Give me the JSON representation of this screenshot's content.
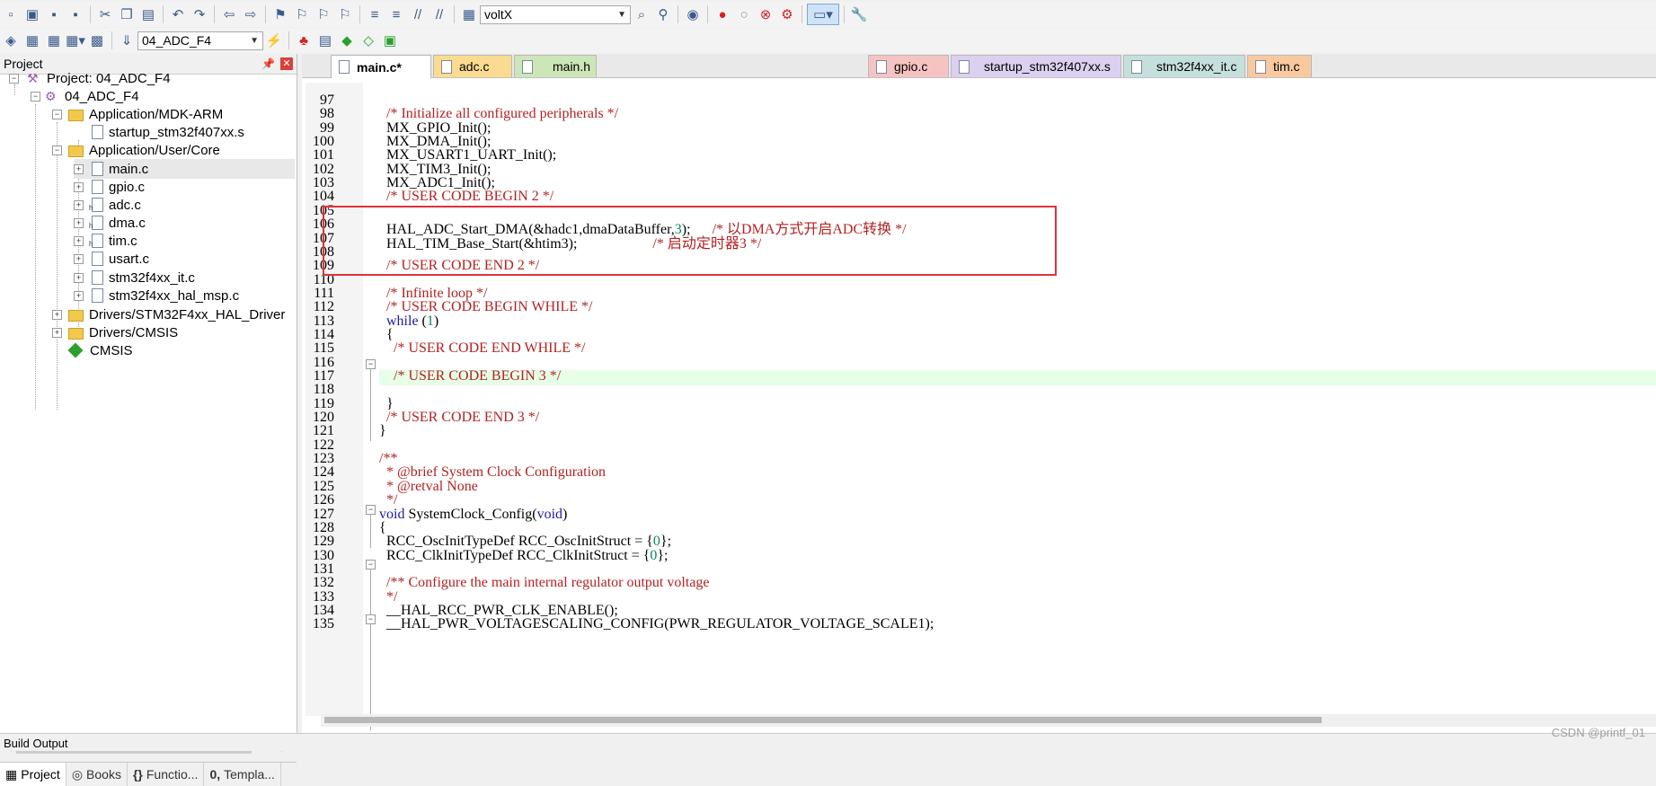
{
  "toolbar": {
    "target_combo": "voltX",
    "project_combo": "04_ADC_F4"
  },
  "project_panel": {
    "title": "Project",
    "root": "Project: 04_ADC_F4",
    "target": "04_ADC_F4",
    "groups": {
      "mdk": "Application/MDK-ARM",
      "startup": "startup_stm32f407xx.s",
      "core": "Application/User/Core",
      "files": [
        "main.c",
        "gpio.c",
        "adc.c",
        "dma.c",
        "tim.c",
        "usart.c",
        "stm32f4xx_it.c",
        "stm32f4xx_hal_msp.c"
      ],
      "drivers": "Drivers/STM32F4xx_HAL_Driver",
      "cmsis_folder": "Drivers/CMSIS",
      "cmsis": "CMSIS"
    },
    "tabs": [
      "Project",
      "Books",
      "Functio...",
      "Templa..."
    ]
  },
  "editor": {
    "tabs": [
      "main.c*",
      "adc.c",
      "main.h",
      "gpio.c",
      "startup_stm32f407xx.s",
      "stm32f4xx_it.c",
      "tim.c"
    ],
    "lines": [
      {
        "n": "97",
        "t": ""
      },
      {
        "n": "98",
        "t": "  /* Initialize all configured peripherals */"
      },
      {
        "n": "99",
        "t": "  MX_GPIO_Init();"
      },
      {
        "n": "100",
        "t": "  MX_DMA_Init();"
      },
      {
        "n": "101",
        "t": "  MX_USART1_UART_Init();"
      },
      {
        "n": "102",
        "t": "  MX_TIM3_Init();"
      },
      {
        "n": "103",
        "t": "  MX_ADC1_Init();"
      },
      {
        "n": "104",
        "t": "  /* USER CODE BEGIN 2 */"
      },
      {
        "n": "105",
        "t": ""
      },
      {
        "n": "106",
        "t": "  HAL_ADC_Start_DMA(&hadc1,dmaDataBuffer,3);      /* 以DMA方式开启ADC转换 */"
      },
      {
        "n": "107",
        "t": "  HAL_TIM_Base_Start(&htim3);                     /* 启动定时器3 */"
      },
      {
        "n": "108",
        "t": ""
      },
      {
        "n": "109",
        "t": "  /* USER CODE END 2 */"
      },
      {
        "n": "110",
        "t": ""
      },
      {
        "n": "111",
        "t": "  /* Infinite loop */"
      },
      {
        "n": "112",
        "t": "  /* USER CODE BEGIN WHILE */"
      },
      {
        "n": "113",
        "t": "  while (1)"
      },
      {
        "n": "114",
        "t": "  {"
      },
      {
        "n": "115",
        "t": "    /* USER CODE END WHILE */"
      },
      {
        "n": "116",
        "t": ""
      },
      {
        "n": "117",
        "t": "    /* USER CODE BEGIN 3 */"
      },
      {
        "n": "118",
        "t": ""
      },
      {
        "n": "119",
        "t": "  }"
      },
      {
        "n": "120",
        "t": "  /* USER CODE END 3 */"
      },
      {
        "n": "121",
        "t": "}"
      },
      {
        "n": "122",
        "t": ""
      },
      {
        "n": "123",
        "t": "/**"
      },
      {
        "n": "124",
        "t": "  * @brief System Clock Configuration"
      },
      {
        "n": "125",
        "t": "  * @retval None"
      },
      {
        "n": "126",
        "t": "  */"
      },
      {
        "n": "127",
        "t": "void SystemClock_Config(void)"
      },
      {
        "n": "128",
        "t": "{"
      },
      {
        "n": "129",
        "t": "  RCC_OscInitTypeDef RCC_OscInitStruct = {0};"
      },
      {
        "n": "130",
        "t": "  RCC_ClkInitTypeDef RCC_ClkInitStruct = {0};"
      },
      {
        "n": "131",
        "t": ""
      },
      {
        "n": "132",
        "t": "  /** Configure the main internal regulator output voltage"
      },
      {
        "n": "133",
        "t": "  */"
      },
      {
        "n": "134",
        "t": "  __HAL_RCC_PWR_CLK_ENABLE();"
      },
      {
        "n": "135",
        "t": "  __HAL_PWR_VOLTAGESCALING_CONFIG(PWR_REGULATOR_VOLTAGE_SCALE1);"
      }
    ]
  },
  "status": {
    "build_output": "Build Output",
    "watermark": "CSDN @printf_01"
  }
}
